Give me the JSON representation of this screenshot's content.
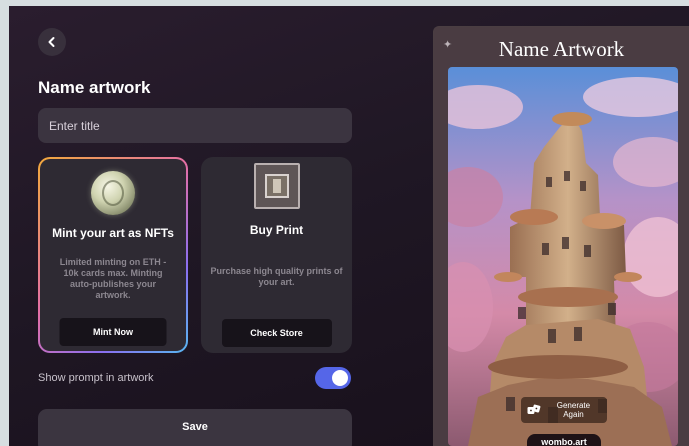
{
  "header": {
    "back_icon": "chevron-left-icon",
    "title": "Name artwork"
  },
  "form": {
    "title_placeholder": "Enter title"
  },
  "cards": {
    "nft": {
      "icon": "coin-icon",
      "title": "Mint your art as NFTs",
      "description": "Limited minting on ETH - 10k cards max. Minting auto-publishes your artwork.",
      "button": "Mint Now",
      "accent_gradient": [
        "#f2a93b",
        "#e46fa6",
        "#8a6ff0",
        "#58b6f0"
      ]
    },
    "print": {
      "icon": "framed-print-icon",
      "title": "Buy Print",
      "description": "Purchase high quality prints of your art.",
      "button": "Check Store"
    }
  },
  "toggle": {
    "label": "Show prompt in artwork",
    "on": true,
    "color": "#5566e8"
  },
  "save": {
    "label": "Save"
  },
  "preview": {
    "title": "Name Artwork",
    "generate_label": "Generate Again",
    "generate_icon": "dice-icon",
    "watermark": "wombo.art"
  }
}
